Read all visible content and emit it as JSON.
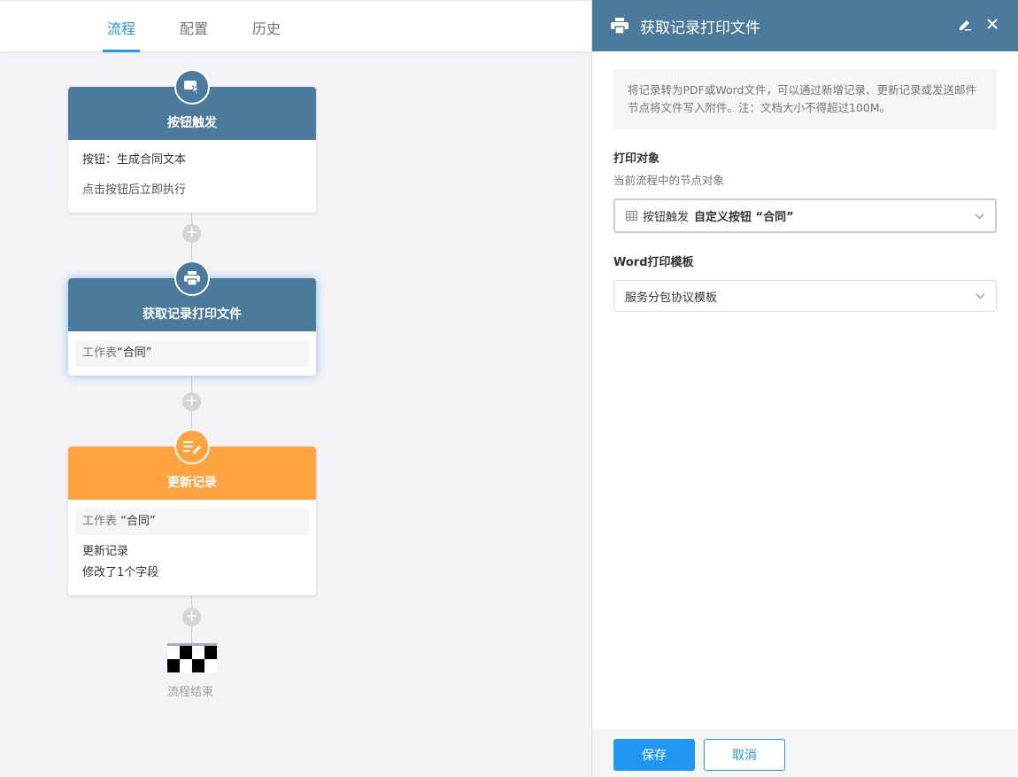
{
  "tabs": [
    {
      "label": "流程",
      "active": true
    },
    {
      "label": "配置",
      "active": false
    },
    {
      "label": "历史",
      "active": false
    }
  ],
  "nodes": {
    "trigger": {
      "title": "按钮触发",
      "icon": "button-cursor-icon",
      "line1": "按钮：生成合同文本",
      "line2": "点击按钮后立即执行"
    },
    "print": {
      "title": "获取记录打印文件",
      "icon": "printer-icon",
      "box_label": "工作表",
      "box_value": "“合同”"
    },
    "update": {
      "title": "更新记录",
      "icon": "edit-list-icon",
      "box_label": "工作表",
      "box_value": "“合同”",
      "line1": "更新记录",
      "line2": "修改了1个字段"
    }
  },
  "add_symbol": "+",
  "end_label": "流程结束",
  "panel": {
    "title": "获取记录打印文件",
    "notice": "将记录转为PDF或Word文件，可以通过新增记录、更新记录或发送邮件节点将文件写入附件。注：文档大小不得超过100M。",
    "target": {
      "title": "打印对象",
      "desc": "当前流程中的节点对象",
      "node_name": "按钮触发",
      "object_name": "自定义按钮 “合同”"
    },
    "template": {
      "title": "Word打印模板",
      "value": "服务分包协议模板"
    },
    "save_label": "保存",
    "cancel_label": "取消"
  },
  "colors": {
    "accent": "#2196f3",
    "node_blue": "#4b7a9d",
    "node_orange": "#ffa340"
  }
}
